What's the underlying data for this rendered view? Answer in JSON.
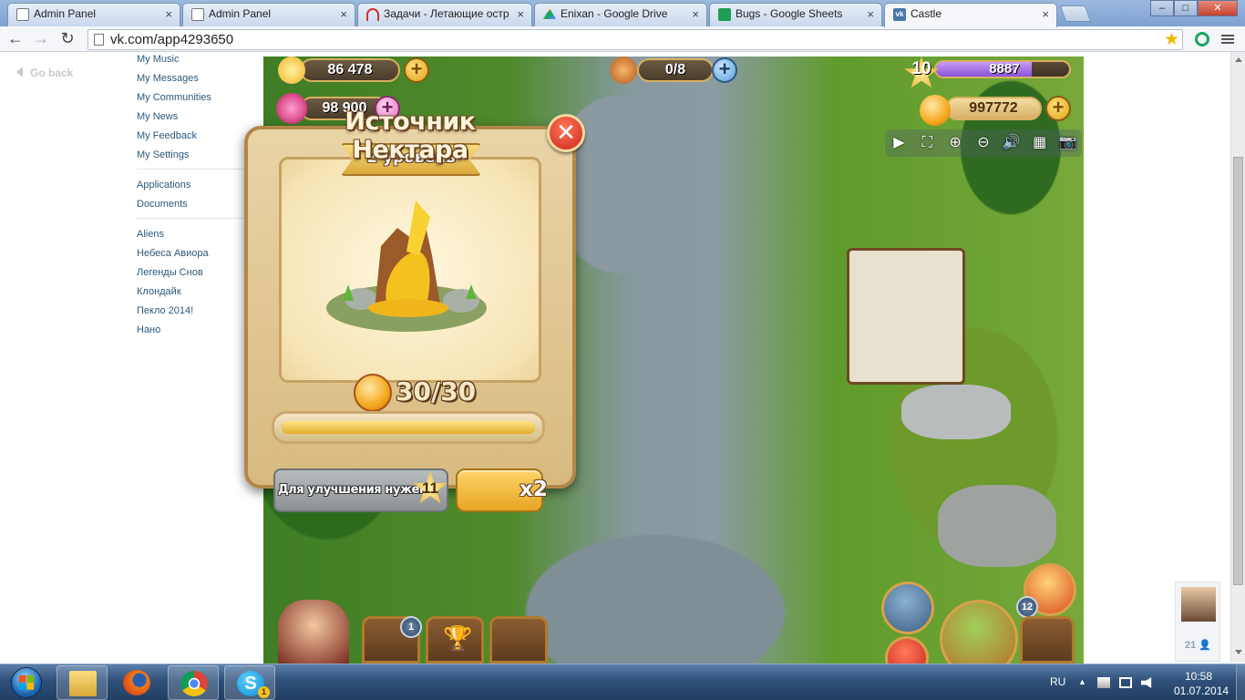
{
  "browser": {
    "tabs": [
      {
        "label": "Admin Panel",
        "icon": "page-icon"
      },
      {
        "label": "Admin Panel",
        "icon": "page-icon"
      },
      {
        "label": "Задачи - Летающие остр",
        "icon": "tasks-icon"
      },
      {
        "label": "Enixan - Google Drive",
        "icon": "google-drive-icon"
      },
      {
        "label": "Bugs - Google Sheets",
        "icon": "google-sheets-icon"
      },
      {
        "label": "Castle",
        "icon": "vk-icon",
        "active": true
      }
    ],
    "tab_close": "×",
    "url": "vk.com/app4293650",
    "window_buttons": {
      "minimize": "–",
      "maximize": "□",
      "close": "✕"
    }
  },
  "sidebar": {
    "go_back": "Go back",
    "groups": [
      [
        "My Music",
        "My Messages",
        "My Communities",
        "My News",
        "My Feedback",
        "My Settings"
      ],
      [
        "Applications",
        "Documents"
      ],
      [
        "Aliens",
        "Небеса Авиора",
        "Легенды Снов",
        "Клондайк",
        "Пекло 2014!",
        "Нано"
      ]
    ]
  },
  "friends_widget": {
    "count": "21"
  },
  "game": {
    "resources": {
      "coins": "86 478",
      "gems": "98 900",
      "pets": "0/8",
      "level": "10",
      "xp": "8887",
      "xp_fraction": 0.72,
      "nectar": "997772"
    },
    "tools": [
      "▶",
      "⛶",
      "⊕",
      "⊖",
      "🔊",
      "▦",
      "📷"
    ],
    "plus": "+",
    "badges": {
      "tasks_count": "1",
      "gifts_count": "12"
    },
    "modal": {
      "title": "Источник Нектара",
      "close": "✕",
      "level_label": "2 уровень",
      "counter": "30/30",
      "progress_fraction": 1.0,
      "requirement_label": "Для улучшения нужен",
      "requirement_level": "11",
      "speed_label": "x2"
    }
  },
  "taskbar": {
    "language": "RU",
    "time": "10:58",
    "date": "01.07.2014",
    "skype_badge": "1"
  },
  "colors": {
    "vk_link": "#2b587a",
    "accent_gold": "#e4ad2c",
    "xp_purple": "#8a52d9"
  }
}
